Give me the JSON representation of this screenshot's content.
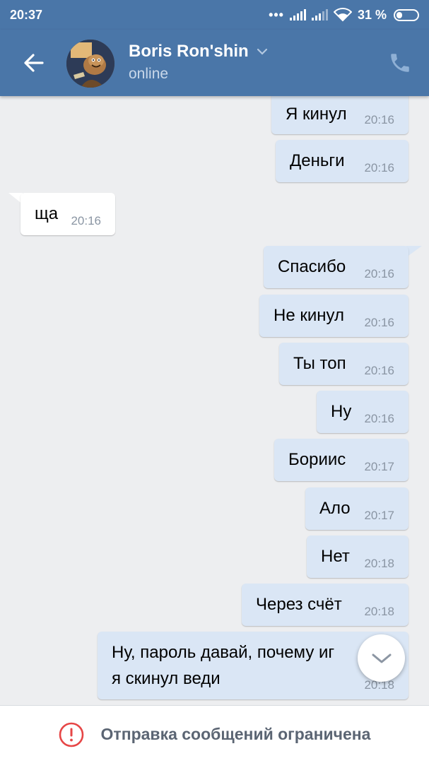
{
  "status_bar": {
    "time": "20:37",
    "dots": "•••",
    "battery": "31 %"
  },
  "header": {
    "name": "Boris Ron'shin",
    "status": "online"
  },
  "messages": [
    {
      "text": "Я кинул",
      "time": "20:16",
      "dir": "out"
    },
    {
      "text": "Деньги",
      "time": "20:16",
      "dir": "out"
    },
    {
      "text": "ща",
      "time": "20:16",
      "dir": "in"
    },
    {
      "text": "Спасибо",
      "time": "20:16",
      "dir": "out"
    },
    {
      "text": "Не кинул",
      "time": "20:16",
      "dir": "out"
    },
    {
      "text": "Ты топ",
      "time": "20:16",
      "dir": "out"
    },
    {
      "text": "Ну",
      "time": "20:16",
      "dir": "out"
    },
    {
      "text": "Бориис",
      "time": "20:17",
      "dir": "out"
    },
    {
      "text": "Ало",
      "time": "20:17",
      "dir": "out"
    },
    {
      "text": "Нет",
      "time": "20:18",
      "dir": "out"
    },
    {
      "text": "Через счёт",
      "time": "20:18",
      "dir": "out"
    },
    {
      "text_line1": "Ну, пароль давай, почему иг",
      "text_line2": "я скинул веди",
      "time": "20:18",
      "dir": "out"
    }
  ],
  "bottom_bar": {
    "notice": "Отправка сообщений ограничена"
  },
  "colors": {
    "header": "#4a76a8",
    "outgoing_bubble": "#dae6f5",
    "incoming_bubble": "#ffffff",
    "background": "#edeef0",
    "alert": "#e64646"
  }
}
